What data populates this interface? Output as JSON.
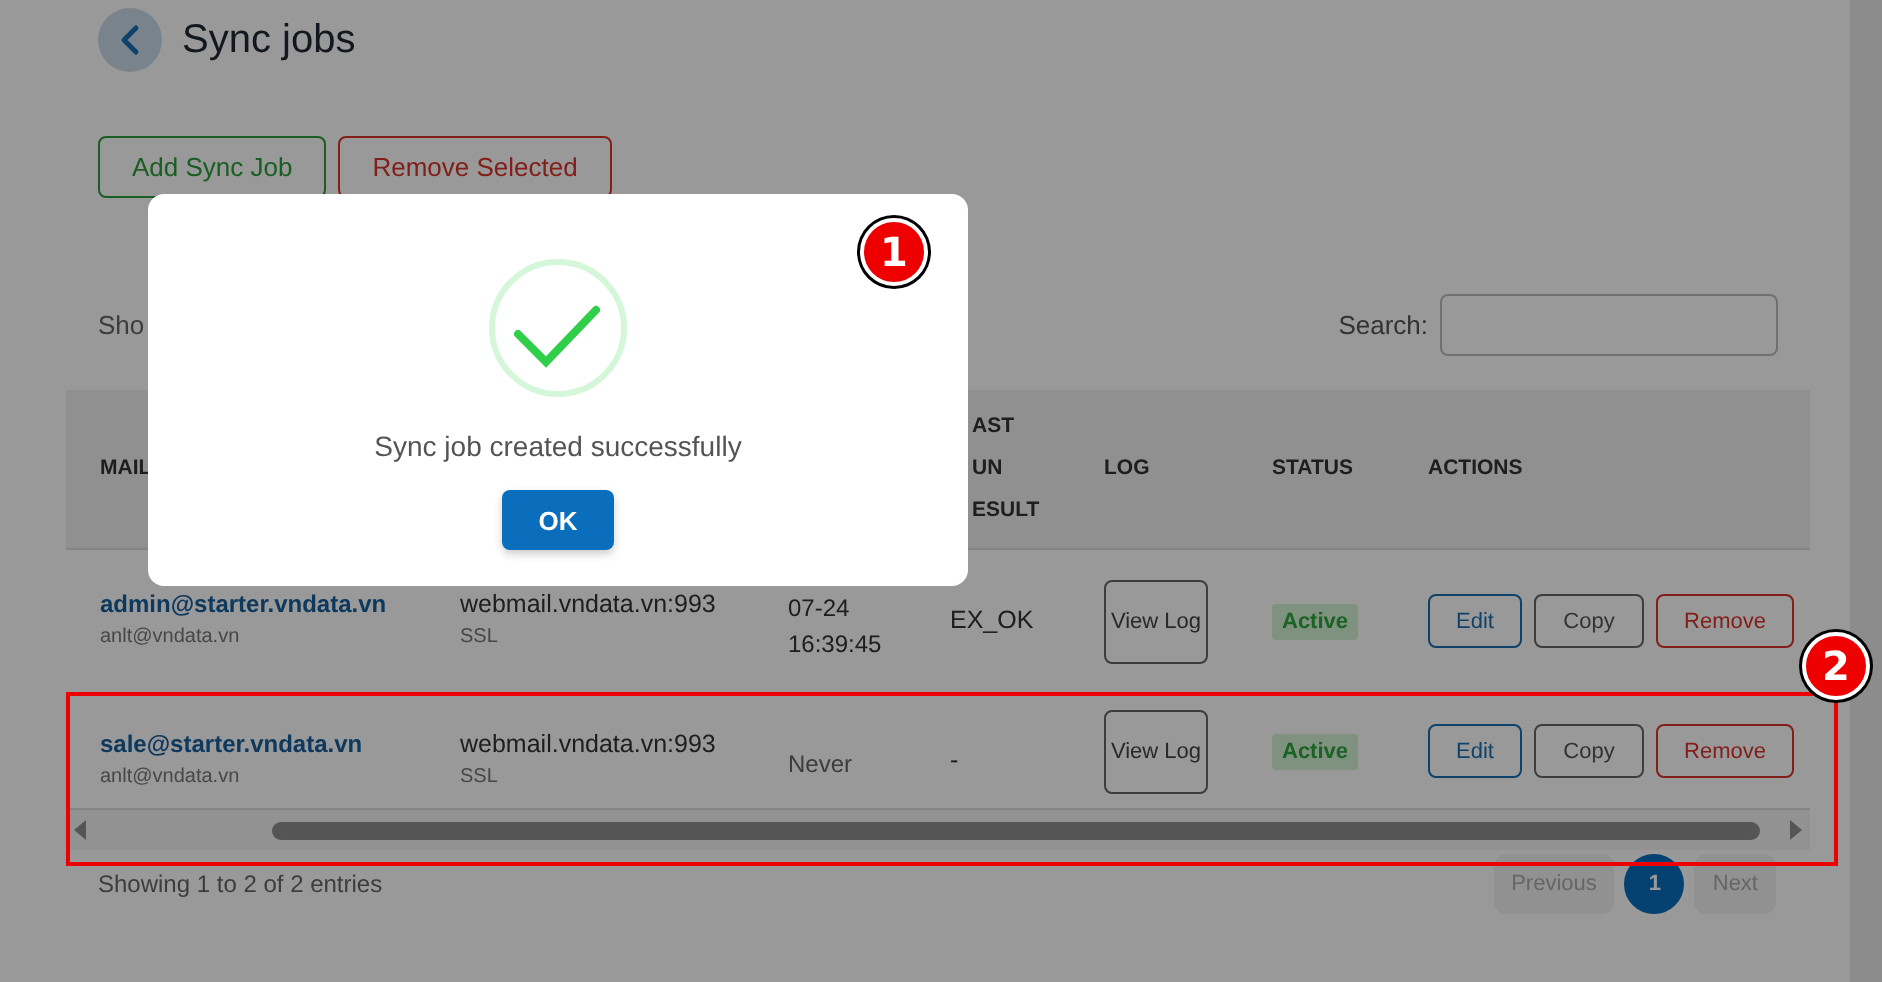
{
  "page": {
    "title": "Sync jobs"
  },
  "toolbar": [
    {
      "label": "Add Sync Job",
      "kind": "add"
    },
    {
      "label": "Remove Selected",
      "kind": "remove"
    }
  ],
  "show_entries": {
    "label": "Sho"
  },
  "search": {
    "label": "Search:"
  },
  "table": {
    "columns": [
      {
        "label": "MAIL"
      },
      {
        "label": "AST UN ESULT"
      },
      {
        "label": "LOG"
      },
      {
        "label": "STATUS"
      },
      {
        "label": "ACTIONS"
      }
    ],
    "rows": [
      {
        "mailbox": "admin@starter.vndata.vn",
        "user": "anlt@vndata.vn",
        "host": "webmail.vndata.vn:993",
        "security": "SSL",
        "last_run": "07-24 16:39:45",
        "result": "EX_OK",
        "log": "View Log",
        "status": "Active",
        "actions": [
          {
            "label": "Edit",
            "kind": "edit"
          },
          {
            "label": "Copy",
            "kind": "copy"
          },
          {
            "label": "Remove",
            "kind": "remove"
          }
        ],
        "highlighted": false
      },
      {
        "mailbox": "sale@starter.vndata.vn",
        "user": "anlt@vndata.vn",
        "host": "webmail.vndata.vn:993",
        "security": "SSL",
        "last_run": "Never",
        "result": "-",
        "log": "View Log",
        "status": "Active",
        "actions": [
          {
            "label": "Edit",
            "kind": "edit"
          },
          {
            "label": "Copy",
            "kind": "copy"
          },
          {
            "label": "Remove",
            "kind": "remove"
          }
        ],
        "highlighted": true
      }
    ]
  },
  "footer": {
    "info": "Showing 1 to 2 of 2 entries"
  },
  "pagination": [
    {
      "label": "Previous",
      "kind": "prev",
      "selected": false,
      "disabled": true
    },
    {
      "label": "1",
      "kind": "page",
      "selected": true,
      "disabled": false
    },
    {
      "label": "Next",
      "kind": "next",
      "selected": false,
      "disabled": true
    }
  ],
  "dialog": {
    "message": "Sync job created successfully",
    "button": "OK"
  },
  "annotations": [
    {
      "label": "1",
      "kind": "dialog"
    },
    {
      "label": "2",
      "kind": "row"
    }
  ]
}
